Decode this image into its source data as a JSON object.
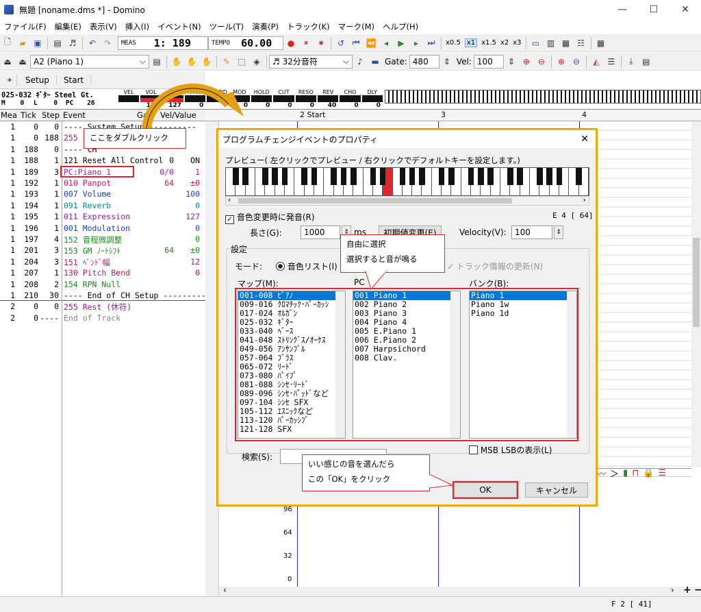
{
  "window": {
    "title": "無題 [noname.dms *] - Domino"
  },
  "menu": [
    "ファイル(F)",
    "編集(E)",
    "表示(V)",
    "挿入(I)",
    "イベント(N)",
    "ツール(T)",
    "演奏(P)",
    "トラック(K)",
    "マーク(M)",
    "ヘルプ(H)"
  ],
  "toolbar": {
    "meas_label": "MEAS",
    "position": "1: 189",
    "tempo_label": "TEMPO",
    "tempo": "60.00",
    "speed_buttons": [
      "x0.5",
      "x1",
      "x1.5",
      "x2",
      "x3"
    ]
  },
  "toolbar2": {
    "track": "A2  (Piano 1)",
    "note_length": "32分音符",
    "gate_label": "Gate:",
    "gate": "480",
    "vel_label": "Vel:",
    "vel": "100"
  },
  "tabs": [
    "Setup",
    "Start"
  ],
  "trackinfo": {
    "name": "025-032 ｷﾞﾀｰ Steel Gt.",
    "m_label": "M",
    "m": "0",
    "l_label": "L",
    "l": "0",
    "pc_label": "PC",
    "pc": "26",
    "params": [
      "VEL",
      "VOL",
      "EXP",
      "PAN",
      "P.BEND",
      "MOD",
      "HOLD",
      "CUT",
      "RESO",
      "REV",
      "CHO",
      "DLY"
    ],
    "values": [
      "",
      "100",
      "127",
      "0",
      "",
      "0",
      "0",
      "0",
      "0",
      "40",
      "0",
      "0"
    ]
  },
  "event_headers": {
    "mea": "Mea",
    "tick": "Tick",
    "step": "Step",
    "event": "Event",
    "gate": "Ga",
    "velvalue": "Vel/Value"
  },
  "events": [
    {
      "mea": "1",
      "tick": "0",
      "step": "0",
      "event": "---- System Setup ----------",
      "gate": "",
      "val": "",
      "color": "#000"
    },
    {
      "mea": "1",
      "tick": "0",
      "step": "188",
      "event": "255",
      "gate": "",
      "val": "",
      "color": "#9a1aa8"
    },
    {
      "mea": "1",
      "tick": "188",
      "step": "0",
      "event": "---- CH",
      "gate": "",
      "val": "",
      "color": "#000"
    },
    {
      "mea": "1",
      "tick": "188",
      "step": "1",
      "event": "121 Reset All Control",
      "gate": "0",
      "val": "ON",
      "color": "#000"
    },
    {
      "mea": "1",
      "tick": "189",
      "step": "3",
      "event": "PC:Piano 1",
      "gate": "0/0",
      "val": "1",
      "color": "#9a1aa8"
    },
    {
      "mea": "1",
      "tick": "192",
      "step": "1",
      "event": "010 Panpot",
      "gate": "64",
      "val": "±0",
      "color": "#c2185b"
    },
    {
      "mea": "1",
      "tick": "193",
      "step": "1",
      "event": "007 Volume",
      "gate": "",
      "val": "100",
      "color": "#1a3dc8"
    },
    {
      "mea": "1",
      "tick": "194",
      "step": "1",
      "event": "091 Reverb",
      "gate": "",
      "val": "0",
      "color": "#0a8a8a"
    },
    {
      "mea": "1",
      "tick": "195",
      "step": "1",
      "event": "011 Expression",
      "gate": "",
      "val": "127",
      "color": "#9a1aa8"
    },
    {
      "mea": "1",
      "tick": "196",
      "step": "1",
      "event": "001 Modulation",
      "gate": "",
      "val": "0",
      "color": "#1a3dc8"
    },
    {
      "mea": "1",
      "tick": "197",
      "step": "4",
      "event": "152 音程微調整",
      "gate": "",
      "val": "0",
      "color": "#1a8a1a"
    },
    {
      "mea": "1",
      "tick": "201",
      "step": "3",
      "event": "153 GM ﾉｰﾄｼﾌﾄ",
      "gate": "64",
      "val": "±0",
      "color": "#1a8a1a"
    },
    {
      "mea": "1",
      "tick": "204",
      "step": "3",
      "event": "151 ﾍﾞﾝﾄﾞ幅",
      "gate": "",
      "val": "12",
      "color": "#c2185b"
    },
    {
      "mea": "1",
      "tick": "207",
      "step": "1",
      "event": "130 Pitch Bend",
      "gate": "",
      "val": "0",
      "color": "#c2185b"
    },
    {
      "mea": "1",
      "tick": "208",
      "step": "2",
      "event": "154 RPN Null",
      "gate": "",
      "val": "",
      "color": "#1a8a1a"
    },
    {
      "mea": "1",
      "tick": "210",
      "step": "30",
      "event": "---- End of CH Setup ----------",
      "gate": "",
      "val": "",
      "color": "#000"
    },
    {
      "mea": "2",
      "tick": "0",
      "step": "0",
      "event": "255 Rest (休符)",
      "gate": "",
      "val": "",
      "color": "#9a1aa8"
    },
    {
      "mea": "2",
      "tick": "0",
      "step": "----",
      "event": "End of Track",
      "gate": "",
      "val": "",
      "color": "#888"
    }
  ],
  "pianoroll": {
    "markers": [
      "2 Start",
      "3",
      "4"
    ],
    "ticks": [
      "96",
      "64",
      "32",
      "0"
    ]
  },
  "dialog": {
    "title": "プログラムチェンジイベントのプロパティ",
    "preview_label": "プレビュー( 左クリックでプレビュー / 右クリックでデフォルトキーを設定します。)",
    "play_on_change": "音色変更時に発音(R)",
    "key_display": "E 4 [ 64]",
    "length_label": "長さ(G):",
    "length": "1000",
    "length_unit": "ms",
    "init_button": "初期値変更(E)",
    "velocity_label": "Velocity(V):",
    "velocity": "100",
    "settings_label": "設定",
    "mode_label": "モード:",
    "mode_value": "音色リスト(I)",
    "track_update": "トラック情報の更新(N)",
    "map_label": "マップ(M):",
    "pc_label": "PC",
    "bank_label": "バンク(B):",
    "maps": [
      "001-008 ﾋﾟｱﾉ",
      "009-016 ｸﾛﾏﾁｯｸ･ﾊﾟｰｶｯｼ",
      "017-024 ｵﾙｶﾞﾝ",
      "025-032 ｷﾞﾀｰ",
      "033-040 ﾍﾞｰｽ",
      "041-048 ｽﾄﾘﾝｸﾞｽ/ｵｰｹｽ",
      "049-056 ｱﾝｻﾝﾌﾞﾙ",
      "057-064 ﾌﾞﾗｽ",
      "065-072 ﾘｰﾄﾞ",
      "073-080 ﾊﾟｲﾌﾟ",
      "081-088 ｼﾝｾ･ﾘｰﾄﾞ",
      "089-096 ｼﾝｾ･ﾊﾟｯﾄﾞなど",
      "097-104 ｼﾝｾ SFX",
      "105-112 ｴｽﾆｯｸなど",
      "113-120 ﾊﾟｰｶｯｼﾌﾞ",
      "121-128 SFX"
    ],
    "programs": [
      "001 Piano 1",
      "002 Piano 2",
      "003 Piano 3",
      "004 Piano 4",
      "005 E.Piano 1",
      "006 E.Piano 2",
      "007 Harpsichord",
      "008 Clav."
    ],
    "banks": [
      "Piano 1",
      "Piano 1w",
      "Piano 1d"
    ],
    "msb_label": "MSB LSBの表示(L)",
    "search_label": "検索(S):",
    "ok": "OK",
    "cancel": "キャンセル"
  },
  "callouts": {
    "doubleclick": "ここをダブルクリック",
    "select1": "自由に選択",
    "select2": "選択すると音が鳴る",
    "ok1": "いい感じの音を選んだら",
    "ok2": "この「OK」をクリック"
  },
  "status": {
    "right": "F 2 [ 41]"
  },
  "colors": {
    "highlight": "#e0262d",
    "accent": "#f4b400",
    "selection": "#0078d7"
  }
}
